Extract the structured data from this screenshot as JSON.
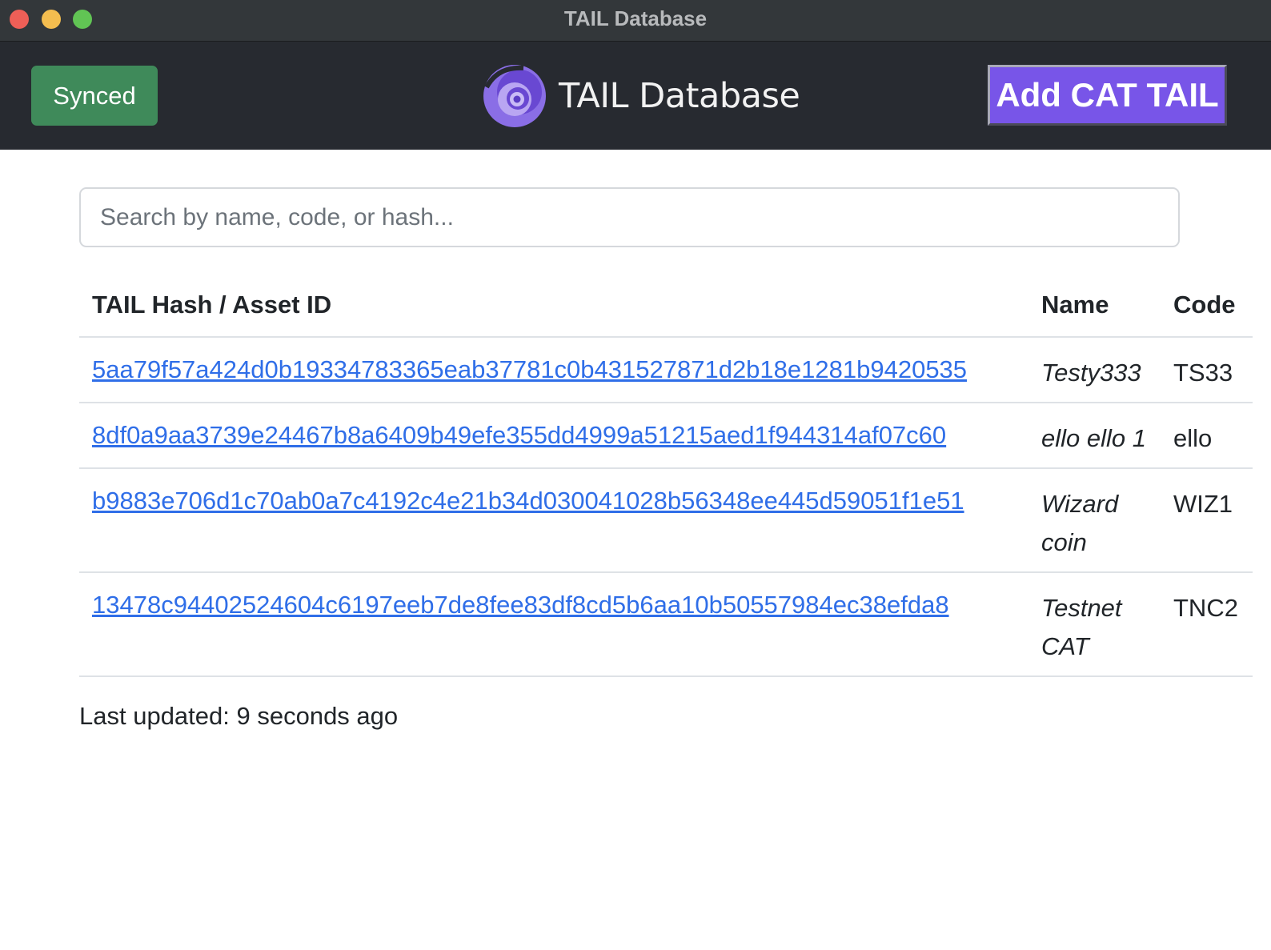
{
  "window": {
    "title": "TAIL Database"
  },
  "header": {
    "sync_status": "Synced",
    "brand_name": "TAIL Database",
    "add_button_label": "Add CAT TAIL",
    "colors": {
      "sync": "#3f8a5a",
      "accent": "#7855e8",
      "bar": "#272a30"
    }
  },
  "search": {
    "placeholder": "Search by name, code, or hash...",
    "value": ""
  },
  "table": {
    "headers": {
      "hash": "TAIL Hash / Asset ID",
      "name": "Name",
      "code": "Code"
    },
    "rows": [
      {
        "hash": "5aa79f57a424d0b19334783365eab37781c0b431527871d2b18e1281b9420535",
        "name": "Testy333",
        "code": "TS33"
      },
      {
        "hash": "8df0a9aa3739e24467b8a6409b49efe355dd4999a51215aed1f944314af07c60",
        "name": "ello ello 1",
        "code": "ello"
      },
      {
        "hash": "b9883e706d1c70ab0a7c4192c4e21b34d030041028b56348ee445d59051f1e51",
        "name": "Wizard coin",
        "code": "WIZ1"
      },
      {
        "hash": "13478c94402524604c6197eeb7de8fee83df8cd5b6aa10b50557984ec38efda8",
        "name": "Testnet CAT",
        "code": "TNC2"
      }
    ]
  },
  "footer": {
    "last_updated": "Last updated: 9 seconds ago"
  }
}
